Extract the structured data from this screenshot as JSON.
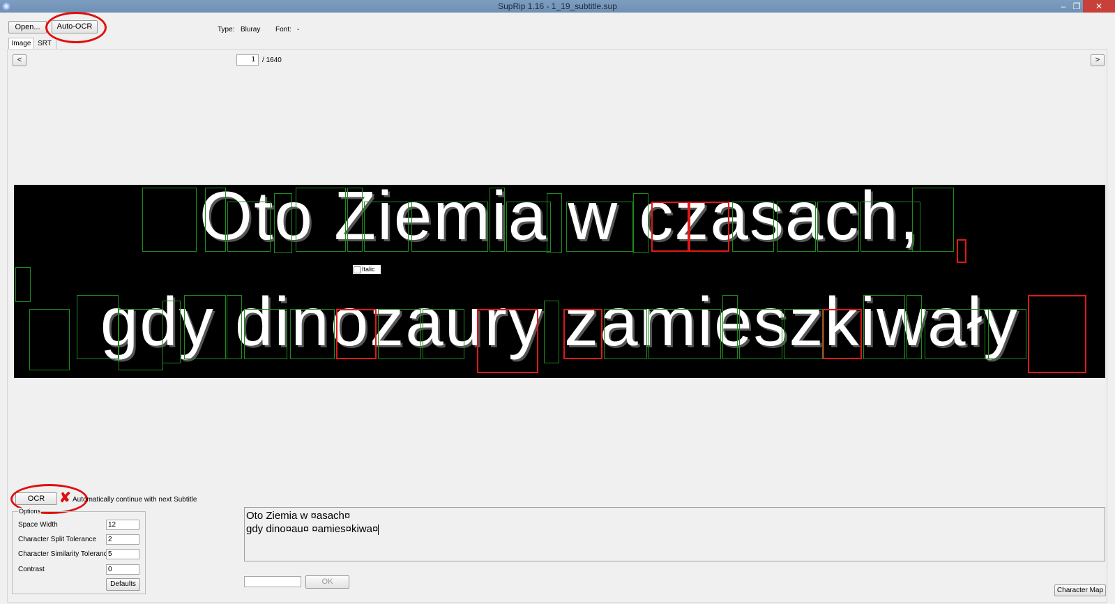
{
  "window": {
    "title": "SupRip 1.16 - 1_19_subtitle.sup"
  },
  "toolbar": {
    "open_label": "Open...",
    "auto_ocr_label": "Auto-OCR",
    "type_label": "Type:",
    "type_value": "Bluray",
    "font_label": "Font:",
    "font_value": "-"
  },
  "tabs": [
    {
      "label": "Image"
    },
    {
      "label": "SRT"
    }
  ],
  "navigation": {
    "prev_label": "<",
    "next_label": ">",
    "page_current": "1",
    "page_total": "/ 1640"
  },
  "subtitle_image": {
    "line1": "Oto Ziemia w czasach,",
    "line2": "gdy dinozaury zamieszkiwały",
    "italic_label": "Italic"
  },
  "ocr": {
    "button_label": "OCR",
    "auto_continue_label": "Automatically continue with next Subtitle",
    "result_line1": "Oto Ziemia w ¤asach¤",
    "result_line2": "gdy dino¤au¤ ¤amies¤kiwa¤"
  },
  "options": {
    "group_label": "Options",
    "space_width_label": "Space Width",
    "space_width_value": "12",
    "split_tolerance_label": "Character Split Tolerance",
    "split_tolerance_value": "2",
    "similarity_tolerance_label": "Character Similarity Tolerance",
    "similarity_tolerance_value": "5",
    "contrast_label": "Contrast",
    "contrast_value": "0",
    "defaults_label": "Defaults"
  },
  "char_entry": {
    "ok_label": "OK",
    "character_map_label": "Character Map"
  },
  "colors": {
    "annotation_red": "#e01010",
    "box_green": "#1e8a1e",
    "titlebar": "#7d9ec0"
  }
}
